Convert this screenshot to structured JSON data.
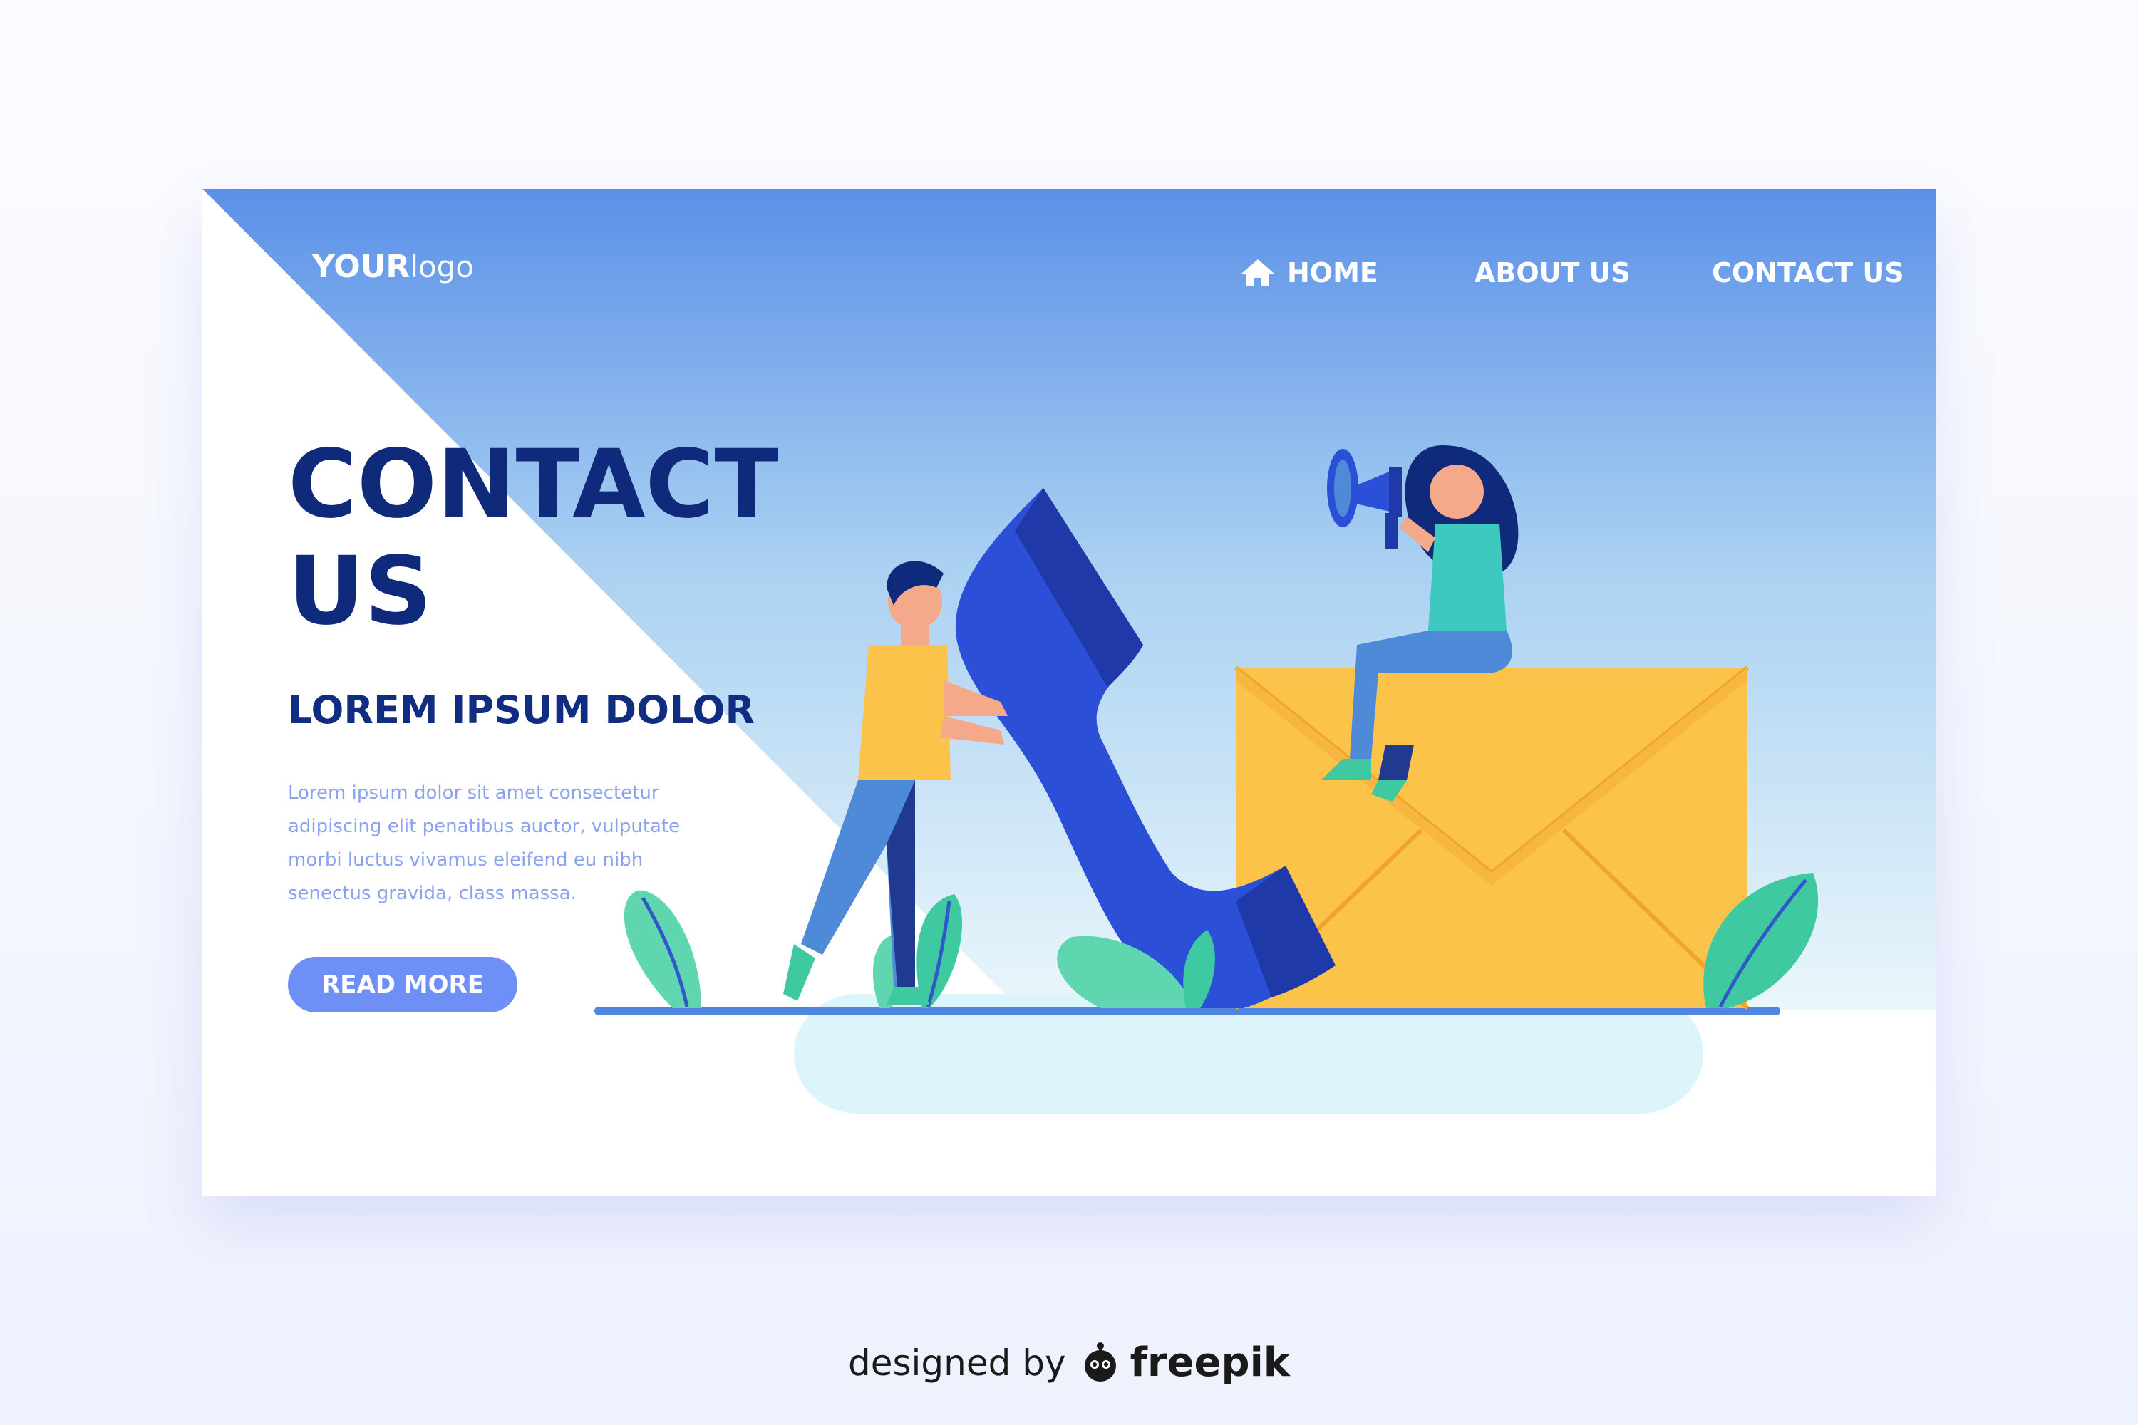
{
  "logo": {
    "bold": "YOUR",
    "light": "logo"
  },
  "nav": {
    "home": "HOME",
    "about": "ABOUT US",
    "contact": "CONTACT US"
  },
  "hero": {
    "title_line1": "CONTACT",
    "title_line2": "US",
    "subtitle": "LOREM IPSUM DOLOR",
    "body": "Lorem ipsum dolor sit amet consectetur adipiscing elit penatibus auctor, vulputate morbi luctus vivamus eleifend eu nibh senectus gravida, class massa.",
    "button": "READ MORE"
  },
  "footer": {
    "designed_by": "designed by",
    "brand": "freepik"
  },
  "colors": {
    "accent": "#6e8ff6",
    "title": "#0f2a7a",
    "gradient_top": "#5b90e8",
    "gradient_bottom": "#eaf7fb",
    "envelope": "#fbc34a",
    "phone": "#2b4fd6",
    "leaf": "#3ec9a0"
  },
  "icons": [
    "home-icon",
    "megaphone-icon",
    "phone-handset-icon",
    "envelope-icon",
    "freepik-logo-icon"
  ]
}
